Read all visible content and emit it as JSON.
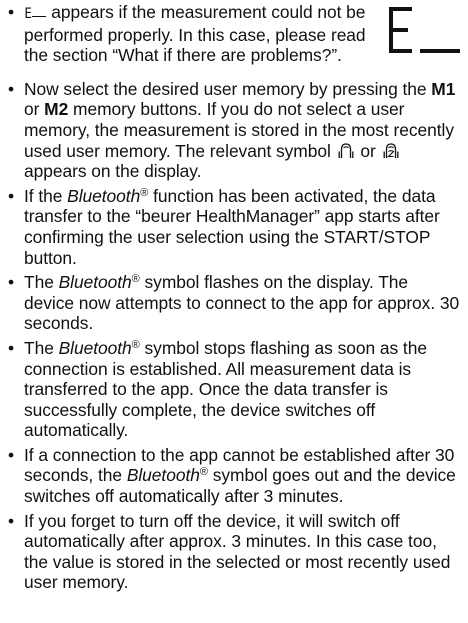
{
  "bullet": "•",
  "error_item": {
    "code": "E",
    "text": "appears if the measurement could not be performed properly. In this case, please read the section “What if there are problems?”.",
    "display_symbol": "E_"
  },
  "memory_item": {
    "part1": "Now select the desired user memory by pressing the",
    "m1": "M1",
    "or1": "or",
    "m2": "M2",
    "part2": "memory buttons. If you do not select a user memory, the measurement is stored in the most recently used user memory. The relevant symbol",
    "or2": "or",
    "part3": "appears on the display."
  },
  "bt_activated_item": {
    "part1": "If the",
    "bluetooth": "Bluetooth",
    "reg": "®",
    "part2": "function has been activated, the data transfer to the “beurer HealthManager” app starts after confirming the user selection using the START/STOP button."
  },
  "bt_flashes_item": {
    "part1": "The",
    "bluetooth": "Bluetooth",
    "reg": "®",
    "part2": "symbol flashes on the display. The device now attempts to connect to the app for approx. 30 seconds."
  },
  "bt_stops_item": {
    "part1": "The",
    "bluetooth": "Bluetooth",
    "reg": "®",
    "part2": "symbol stops flashing as soon as the connection is established. All measurement data is transferred to the app. Once the data transfer is successfully complete, the device switches off automatically."
  },
  "bt_fail_item": {
    "part1": "If a connection to the app cannot be established after 30 seconds, the",
    "bluetooth": "Bluetooth",
    "reg": "®",
    "part2": "symbol goes out and the device switches off automatically after 3 minutes."
  },
  "autooff_item": {
    "text": "If you forget to turn off the device, it will switch off automatically after approx. 3 minutes. In this case too, the value is stored in the selected or most recently used user memory."
  }
}
